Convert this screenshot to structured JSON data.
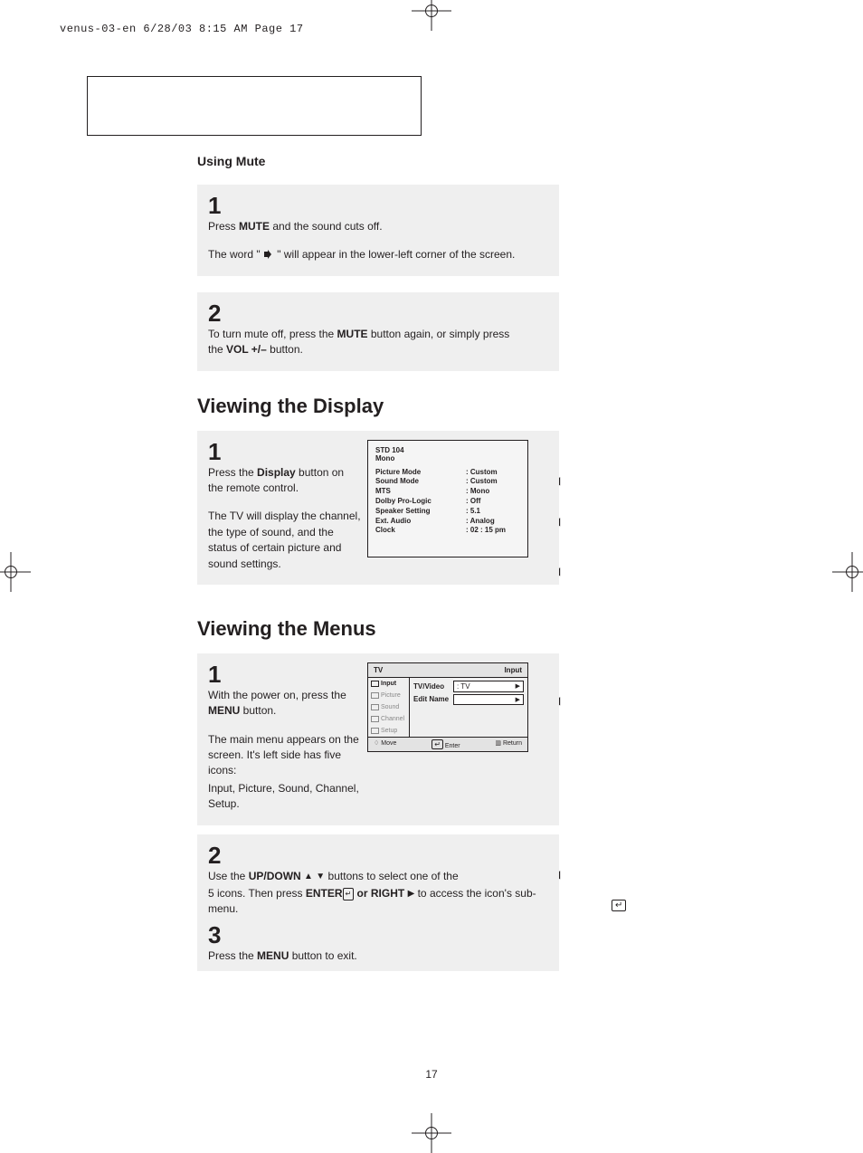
{
  "slug": "venus-03-en  6/28/03 8:15 AM  Page 17",
  "pagenum": "17",
  "sec_mute_title": "Using Mute",
  "mute": {
    "s1_num": "1",
    "s1_a": "Press ",
    "s1_b": "MUTE",
    "s1_c": " and the sound cuts off.",
    "s1_d": "The word  \" ",
    "s1_e": " \" will appear in the lower-left corner of the screen.",
    "s2_num": "2",
    "s2_a": "To turn mute off, press the ",
    "s2_b": "MUTE",
    "s2_c": " button again, or simply press the ",
    "s2_d": "VOL +/–",
    "s2_e": " button."
  },
  "sec_display_title": "Viewing the Display",
  "display": {
    "s1_num": "1",
    "s1_a": "Press the ",
    "s1_b": "Display",
    "s1_c": " button on the remote  control.",
    "s1_d": "The TV will display the channel, the type of sound, and the status of certain picture and sound settings."
  },
  "tvshot": {
    "hdr1": "STD  104",
    "hdr2": "Mono",
    "rows": [
      {
        "k": "Picture Mode",
        "v": ": Custom"
      },
      {
        "k": "Sound Mode",
        "v": ": Custom"
      },
      {
        "k": "MTS",
        "v": ":  Mono"
      },
      {
        "k": "Dolby Pro-Logic",
        "v": ": Off"
      },
      {
        "k": "Speaker Setting",
        "v": ": 5.1"
      },
      {
        "k": "Ext. Audio",
        "v": ": Analog"
      },
      {
        "k": "Clock",
        "v": ": 02 : 15 pm"
      }
    ]
  },
  "sec_menus_title": "Viewing the Menus",
  "menus": {
    "s1_num": "1",
    "s1_a": "With the power on, press the ",
    "s1_b": "MENU",
    "s1_c": " button.",
    "s1_d": "The main menu appears on the screen. It's left side has five icons:",
    "s1_e": "Input, Picture, Sound, Channel, Setup.",
    "s2_num": "2",
    "s2_a": "Use the ",
    "s2_b": "UP/DOWN",
    "s2_c": " buttons to select one of the",
    "s2_d": "5 icons. Then press ",
    "s2_e": "ENTER",
    "s2_f": "  or RIGHT ",
    "s2_g": " to access the icon's sub-menu.",
    "s3_num": "3",
    "s3_a": "Press the ",
    "s3_b": "MENU",
    "s3_c": " button to exit."
  },
  "menushot": {
    "title_l": "TV",
    "title_r": "Input",
    "side": [
      "Input",
      "Picture",
      "Sound",
      "Channel",
      "Setup"
    ],
    "rows": [
      {
        "lbl": "TV/Video",
        "val": ":  TV",
        "arrow": "▶"
      },
      {
        "lbl": "Edit Name",
        "val": "",
        "arrow": "▶"
      }
    ],
    "ftr_move": "Move",
    "ftr_enter": "Enter",
    "ftr_return": "Return"
  }
}
